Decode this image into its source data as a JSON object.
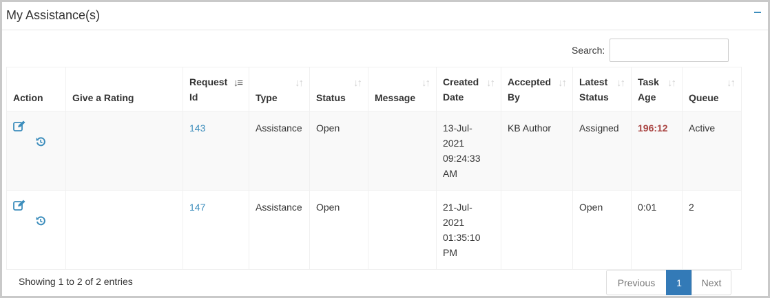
{
  "panel": {
    "title": "My Assistance(s)"
  },
  "search": {
    "label": "Search:",
    "value": "",
    "placeholder": ""
  },
  "table": {
    "columns": [
      {
        "label": "Action"
      },
      {
        "label": "Give a Rating"
      },
      {
        "label": "Request Id"
      },
      {
        "label": "Type"
      },
      {
        "label": "Status"
      },
      {
        "label": "Message"
      },
      {
        "label": "Created Date"
      },
      {
        "label": "Accepted By"
      },
      {
        "label": "Latest Status"
      },
      {
        "label": "Task Age"
      },
      {
        "label": "Queue"
      }
    ],
    "rows": [
      {
        "rating": "",
        "request_id": "143",
        "type": "Assistance",
        "status": "Open",
        "message": "",
        "created_date": "13-Jul-2021 09:24:33 AM",
        "accepted_by": "KB Author",
        "latest_status": "Assigned",
        "task_age": "196:12",
        "queue": "Active"
      },
      {
        "rating": "",
        "request_id": "147",
        "type": "Assistance",
        "status": "Open",
        "message": "",
        "created_date": "21-Jul-2021 01:35:10 PM",
        "accepted_by": "",
        "latest_status": "Open",
        "task_age": "0:01",
        "queue": "2"
      }
    ]
  },
  "footer": {
    "info": "Showing 1 to 2 of 2 entries"
  },
  "pagination": {
    "previous": "Previous",
    "current": "1",
    "next": "Next"
  },
  "icons": {
    "edit": "edit-icon",
    "history": "history-icon",
    "collapse": "collapse-icon",
    "sort": "sort-icon",
    "sort_active": "sort-ascending-icon"
  },
  "colors": {
    "link": "#3c8dbc",
    "late": "#a94442",
    "active_page": "#337ab7"
  }
}
